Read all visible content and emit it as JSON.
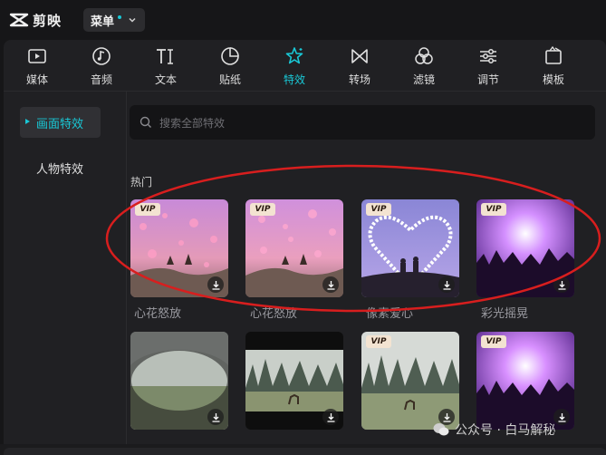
{
  "app": {
    "name": "剪映"
  },
  "menu": {
    "label": "菜单"
  },
  "tabs": [
    {
      "label": "媒体",
      "icon": "media-icon",
      "active": false
    },
    {
      "label": "音频",
      "icon": "audio-icon",
      "active": false
    },
    {
      "label": "文本",
      "icon": "text-icon",
      "active": false
    },
    {
      "label": "贴纸",
      "icon": "sticker-icon",
      "active": false
    },
    {
      "label": "特效",
      "icon": "effects-icon",
      "active": true
    },
    {
      "label": "转场",
      "icon": "transition-icon",
      "active": false
    },
    {
      "label": "滤镜",
      "icon": "filter-icon",
      "active": false
    },
    {
      "label": "调节",
      "icon": "adjust-icon",
      "active": false
    },
    {
      "label": "模板",
      "icon": "template-icon",
      "active": false
    }
  ],
  "sidebar": {
    "items": [
      {
        "label": "画面特效",
        "active": true
      },
      {
        "label": "人物特效",
        "active": false
      }
    ]
  },
  "search": {
    "placeholder": "搜索全部特效"
  },
  "section": {
    "title": "热门"
  },
  "cards_row1": [
    {
      "label": "心花怒放",
      "vip": true,
      "badge": "VIP"
    },
    {
      "label": "心花怒放",
      "vip": true,
      "badge": "VIP"
    },
    {
      "label": "像素爱心",
      "vip": true,
      "badge": "VIP"
    },
    {
      "label": "彩光摇晃",
      "vip": true,
      "badge": "VIP"
    }
  ],
  "cards_row2": [
    {
      "vip": false
    },
    {
      "vip": false
    },
    {
      "vip": true,
      "badge": "VIP"
    },
    {
      "vip": true,
      "badge": "VIP"
    }
  ],
  "watermark": {
    "text": "公众号 · 白马解秘"
  },
  "colors": {
    "accent": "#19c8d6",
    "annotation": "#d81e1e",
    "background": "#161618",
    "panel": "#202023"
  }
}
